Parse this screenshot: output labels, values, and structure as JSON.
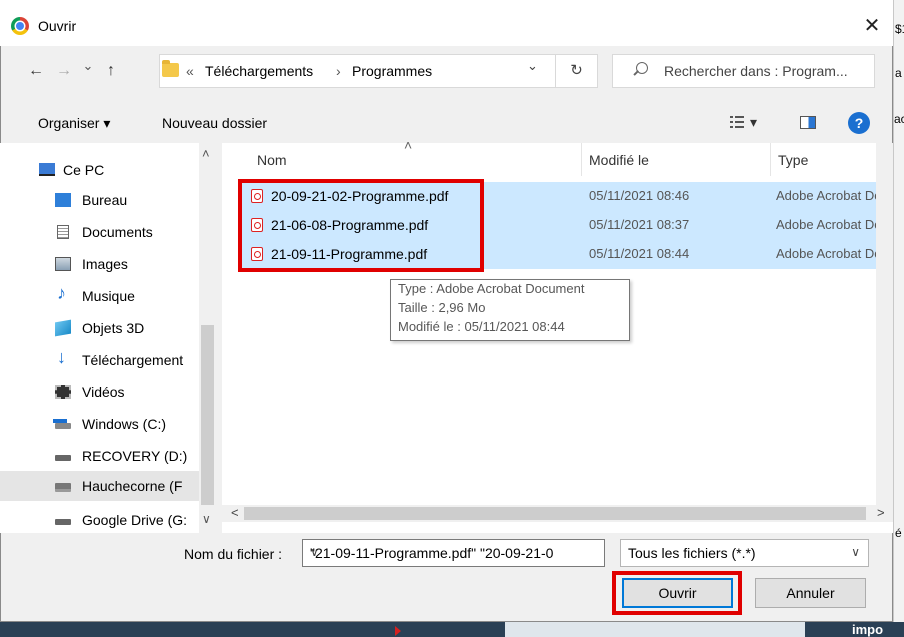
{
  "window": {
    "title": "Ouvrir",
    "close_glyph": "✕"
  },
  "background": {
    "clip_top": "$1",
    "clip_mid1": "a",
    "clip_mid2": "ac",
    "clip_right": "é",
    "bottom_text": "impo"
  },
  "nav": {
    "back": "←",
    "forward": "→",
    "dropdown": "⌄",
    "up": "↑",
    "breadcrumb_prefix": "«",
    "breadcrumb": [
      "Téléchargements",
      "Programmes"
    ],
    "separator": "›",
    "address_dropdown": "⌄",
    "refresh": "↻",
    "search_placeholder": "Rechercher dans : Program..."
  },
  "toolbar": {
    "organize": "Organiser ▾",
    "new_folder": "Nouveau dossier",
    "view_dropdown": "▾",
    "help": "?"
  },
  "sidebar": {
    "items": [
      {
        "label": "Ce PC",
        "icon": "computer-icon"
      },
      {
        "label": "Bureau",
        "icon": "desktop-icon"
      },
      {
        "label": "Documents",
        "icon": "documents-icon"
      },
      {
        "label": "Images",
        "icon": "images-icon"
      },
      {
        "label": "Musique",
        "icon": "music-icon"
      },
      {
        "label": "Objets 3D",
        "icon": "3d-objects-icon"
      },
      {
        "label": "Téléchargement",
        "icon": "downloads-icon"
      },
      {
        "label": "Vidéos",
        "icon": "videos-icon"
      },
      {
        "label": "Windows (C:)",
        "icon": "drive-icon"
      },
      {
        "label": "RECOVERY (D:)",
        "icon": "drive-icon"
      },
      {
        "label": "Hauchecorne (F",
        "icon": "network-drive-icon"
      },
      {
        "label": "Google Drive (G:",
        "icon": "drive-icon"
      }
    ],
    "scroll_up": "˄",
    "expand_glyph": "∨"
  },
  "columns": {
    "name": "Nom",
    "modified": "Modifié le",
    "type": "Type",
    "sort_indicator": "˄"
  },
  "files": [
    {
      "name": "20-09-21-02-Programme.pdf",
      "modified": "05/11/2021 08:46",
      "type": "Adobe Acrobat Document"
    },
    {
      "name": "21-06-08-Programme.pdf",
      "modified": "05/11/2021 08:37",
      "type": "Adobe Acrobat Document"
    },
    {
      "name": "21-09-11-Programme.pdf",
      "modified": "05/11/2021 08:44",
      "type": "Adobe Acrobat Document"
    }
  ],
  "tooltip": {
    "type": "Type : Adobe Acrobat Document",
    "size": "Taille : 2,96 Mo",
    "modified": "Modifié le : 05/11/2021 08:44"
  },
  "hscroll": {
    "left": "<",
    "right": ">"
  },
  "filename": {
    "label": "Nom du fichier :",
    "value": "\"21-09-11-Programme.pdf\" \"20-09-21-0",
    "dropdown": "∨"
  },
  "filter": {
    "value": "Tous les fichiers (*.*)",
    "dropdown": "∨"
  },
  "buttons": {
    "open": "Ouvrir",
    "cancel": "Annuler"
  },
  "colors": {
    "selection": "#cce8ff",
    "highlight_box": "#e00000",
    "accent": "#0078d7"
  }
}
